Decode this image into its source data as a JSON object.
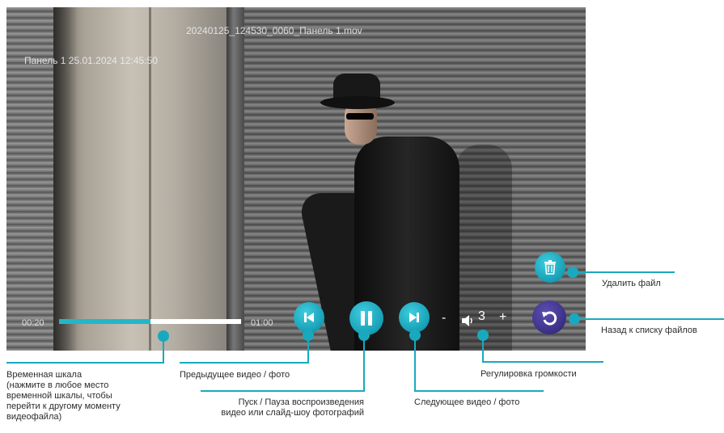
{
  "player": {
    "filename": "20240125_124530_0060_Панель 1.mov",
    "overlay_stamp": "Панель 1 25.01.2024 12:45:50",
    "time_current": "00:20",
    "time_total": "01:00",
    "progress": 0.5,
    "volume_minus": "-",
    "volume_plus": "+",
    "volume_level": "3"
  },
  "icons": {
    "prev": "skip-previous-icon",
    "pause": "pause-icon",
    "next": "skip-next-icon",
    "volume": "speaker-icon",
    "delete": "trash-icon",
    "back": "undo-arrow-icon"
  },
  "colors": {
    "accent": "#19a9bf",
    "back_button": "#3a2f86",
    "progress_fill": "#22b6c8"
  },
  "annotations": {
    "timeline": "Временная шкала\n(нажмите в любое место\nвременной шкалы, чтобы\nперейти к другому моменту\nвидеофайла)",
    "prev": "Предыдущее видео / фото",
    "play_pause": "Пуск / Пауза воспроизведения\nвидео или слайд-шоу фотографий",
    "next": "Следующее видео / фото",
    "volume": "Регулировка громкости",
    "delete": "Удалить файл",
    "back": "Назад к списку файлов"
  }
}
